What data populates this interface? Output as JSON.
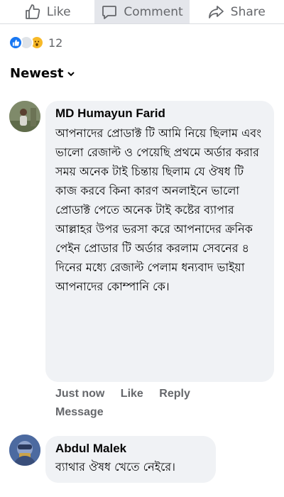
{
  "actions": {
    "like_label": "Like",
    "comment_label": "Comment",
    "share_label": "Share"
  },
  "reactions": {
    "count": "12",
    "icons": [
      "like-icon",
      "care-icon",
      "wow-icon"
    ]
  },
  "sort": {
    "label": "Newest"
  },
  "comments": [
    {
      "author": "MD Humayun Farid",
      "text": "আপনাদের প্রোডাক্ট টি আমি নিয়ে ছিলাম এবং ভালো রেজাল্ট ও পেয়েছি প্রথমে অর্ডার করার সময় অনেক টাই চিন্তায় ছিলাম যে ঔষধ টি কাজ করবে কিনা কারণ অনলাইনে ভালো প্রোডাক্ট পেতে অনেক টাই কষ্টের ব্যাপার আল্লাহর উপর ভরসা করে আপনাদের ক্রনিক পেইন প্রোডার টি অর্ডার করলাম সেবনের ৪ দিনের মধ্যে রেজাল্ট পেলাম ধন্যবাদ ভাইয়া আপনাদের কোম্পানি কে।",
      "time": "Just now",
      "like_label": "Like",
      "reply_label": "Reply",
      "message_label": "Message"
    },
    {
      "author": "Abdul Malek",
      "text": "ব্যাথার ঔষধ খেতে নেইরে।"
    }
  ],
  "colors": {
    "bubble": "#f0f2f5",
    "meta_text": "#65676b",
    "like_blue": "#1877f2"
  }
}
